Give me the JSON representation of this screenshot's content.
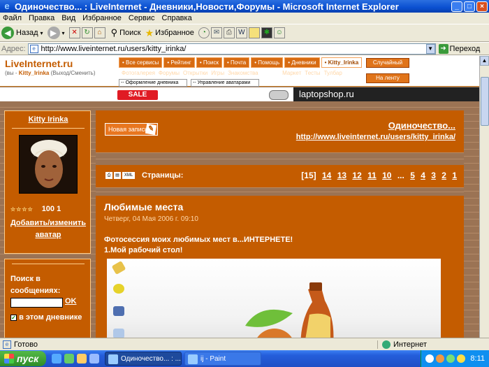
{
  "window": {
    "title": "Одиночество... : LiveInternet - Дневники,Новости,Форумы - Microsoft Internet Explorer"
  },
  "menu": [
    "Файл",
    "Правка",
    "Вид",
    "Избранное",
    "Сервис",
    "Справка"
  ],
  "toolbar": {
    "back": "Назад",
    "search": "Поиск",
    "favorites": "Избранное"
  },
  "address": {
    "label": "Адрес:",
    "url": "http://www.liveinternet.ru/users/kitty_irinka/",
    "go": "Переход"
  },
  "li": {
    "logo": "LiveInternet.ru",
    "user_prefix": "(вы - ",
    "user_name": "Kitty_Irinka",
    "user_suffix": " (Выход/Сменить)",
    "tabs": [
      "• Все сервисы",
      "• Рейтинг",
      "• Поиск",
      "• Почта",
      "• Помощь",
      "• Дневники",
      "• Kitty_Irinka"
    ],
    "subnav": [
      "Фотогалерея",
      "Форумы",
      "Открытки",
      "Игры",
      "Знакомства",
      "Радио",
      "Маркет",
      "Тесты",
      "Тулбар"
    ],
    "drop1": "-- Оформление дневника",
    "drop2": "-- Управление аватарами",
    "random": "Случайный",
    "feed": "На ленту",
    "ad_sale": "SALE",
    "ad_text": "laptopshop.ru"
  },
  "sidebar": {
    "username": "Kitty Irinka",
    "stats": "100 1",
    "change_avatar": "Добавить/изменить аватар",
    "search_label": "Поиск в сообщениях:",
    "ok": "OK",
    "in_diary": "в этом дневнике"
  },
  "main": {
    "new_post": "Новая запись",
    "blog_title": "Одиночество...",
    "blog_url": "http://www.liveinternet.ru/users/kitty_irinka/",
    "pages_label": "Страницы:",
    "pages": [
      "[15]",
      "14",
      "13",
      "12",
      "11",
      "10",
      "...",
      "5",
      "4",
      "3",
      "2",
      "1"
    ],
    "post_title": "Любимые места",
    "post_date": "Четверг, 04 Мая 2006 г. 09:10",
    "post_line1": "Фотосессия моих любимых мест в...ИНТЕРНЕТЕ!",
    "post_line2": "1.Мой рабочий стол!"
  },
  "status": {
    "done": "Готово",
    "zone": "Интернет"
  },
  "taskbar": {
    "start": "пуск",
    "task1": "Одиночество... : ...",
    "task2": "ij - Paint",
    "clock": "8:11"
  }
}
